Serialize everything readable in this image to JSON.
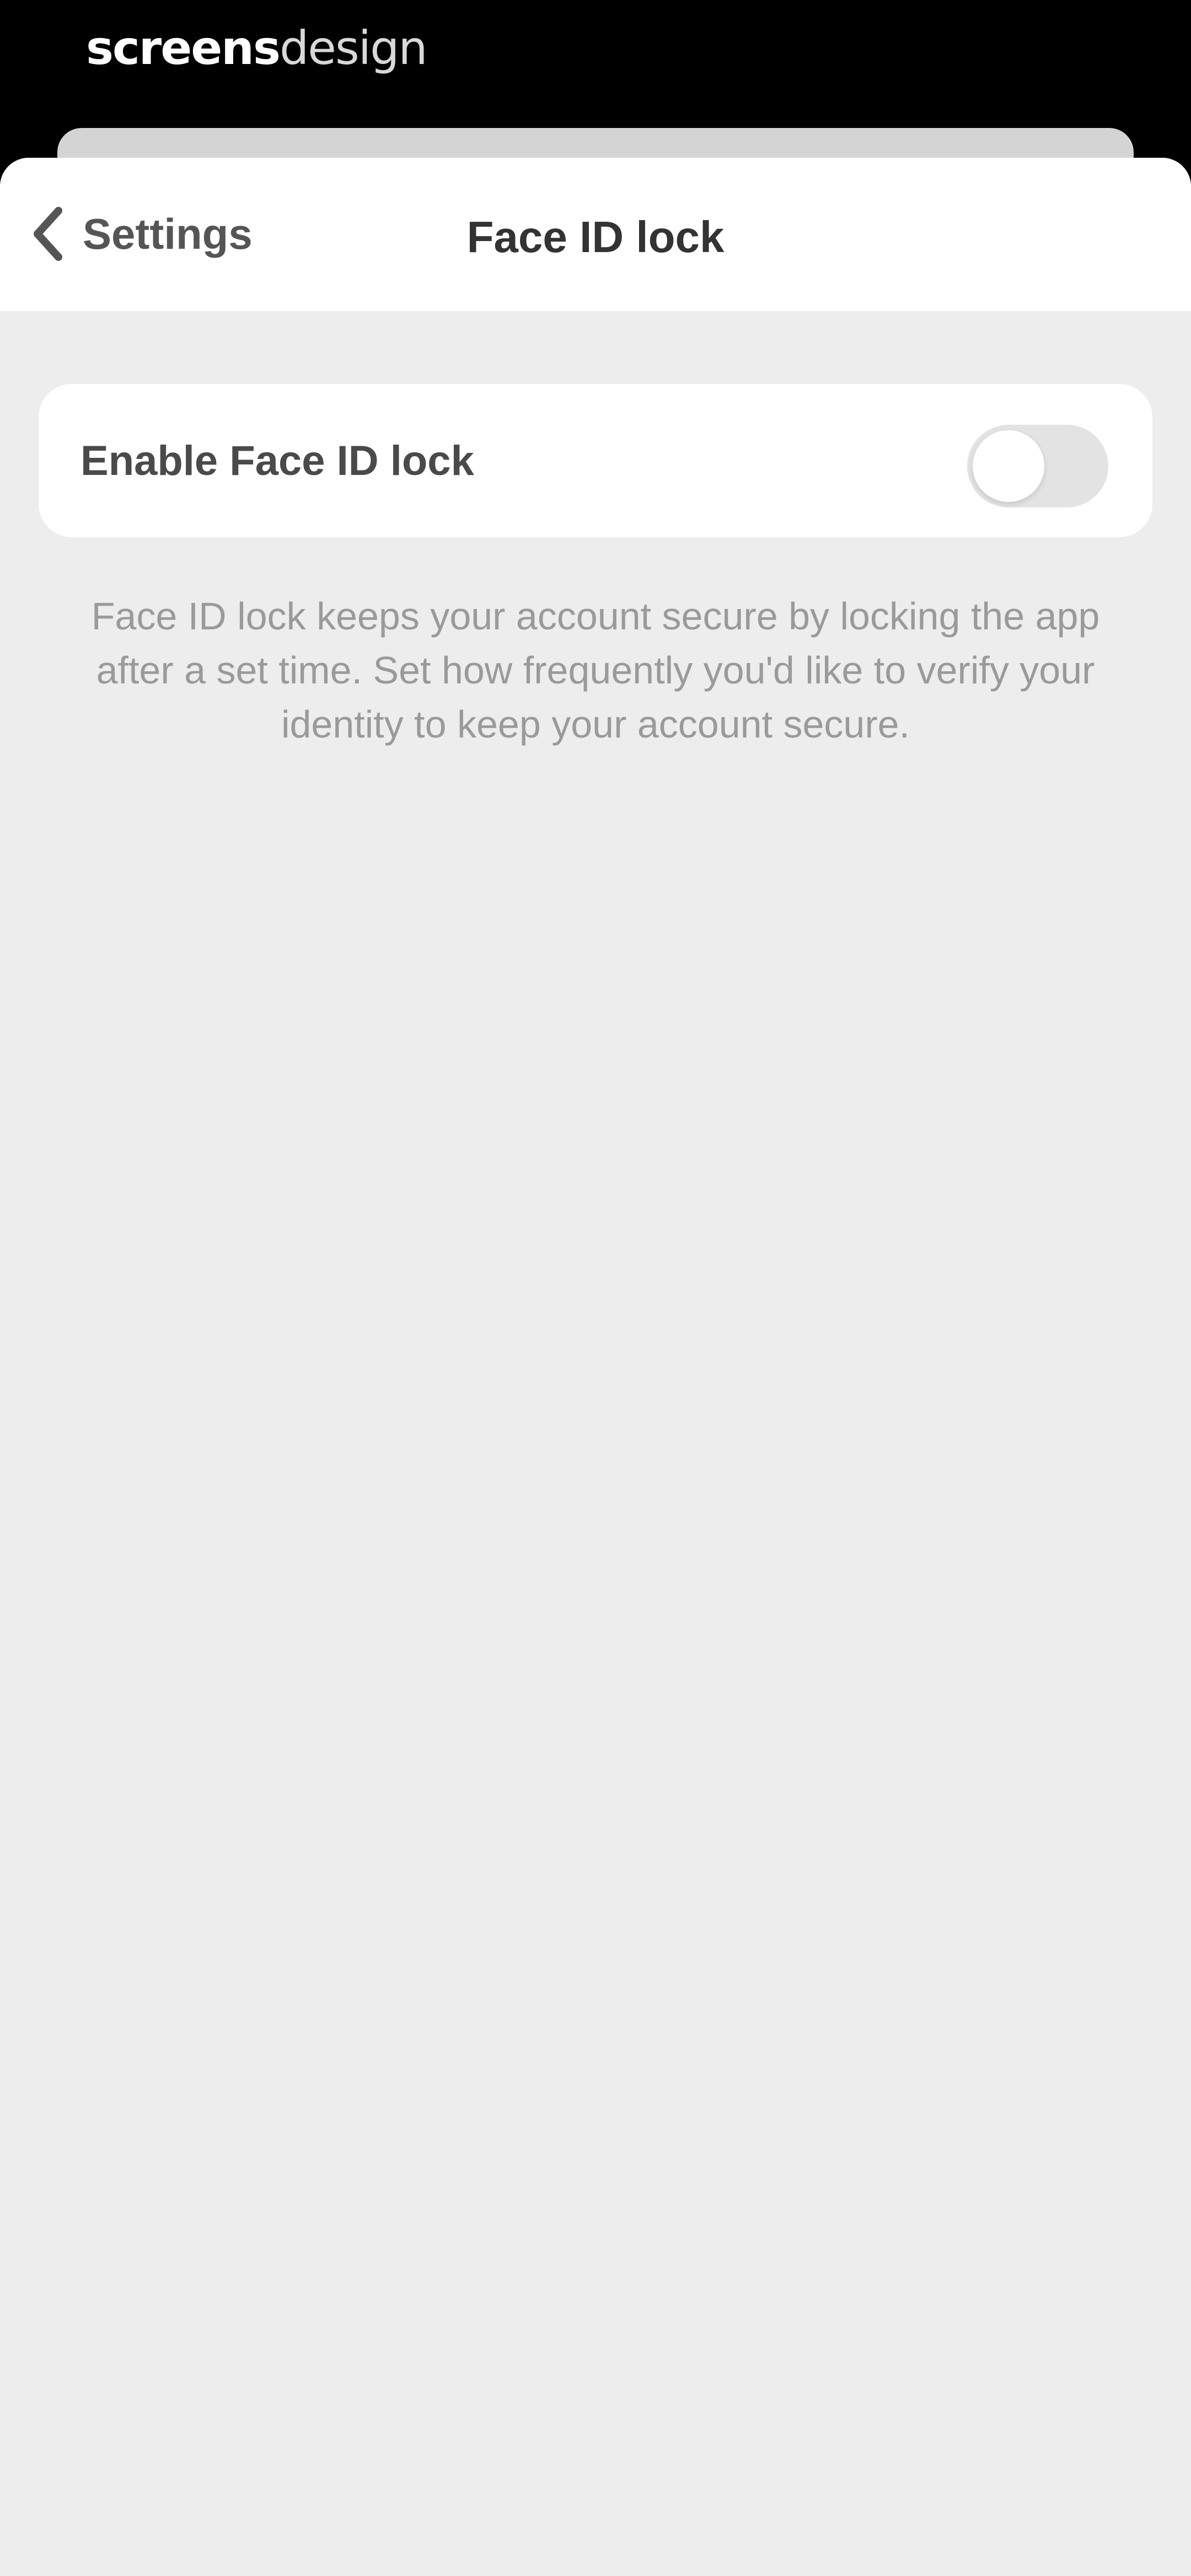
{
  "watermark": {
    "bold": "screens",
    "light": "design"
  },
  "nav": {
    "back_label": "Settings",
    "title": "Face ID lock",
    "back_icon": "chevron-left-icon"
  },
  "setting": {
    "label": "Enable Face ID lock",
    "enabled": false
  },
  "description": "Face ID lock keeps your account secure by locking the app after a set time. Set how frequently you'd like to verify your identity to keep your account secure.",
  "colors": {
    "background": "#ededed",
    "card": "#ffffff",
    "toggle_off": "#e3e3e3"
  }
}
